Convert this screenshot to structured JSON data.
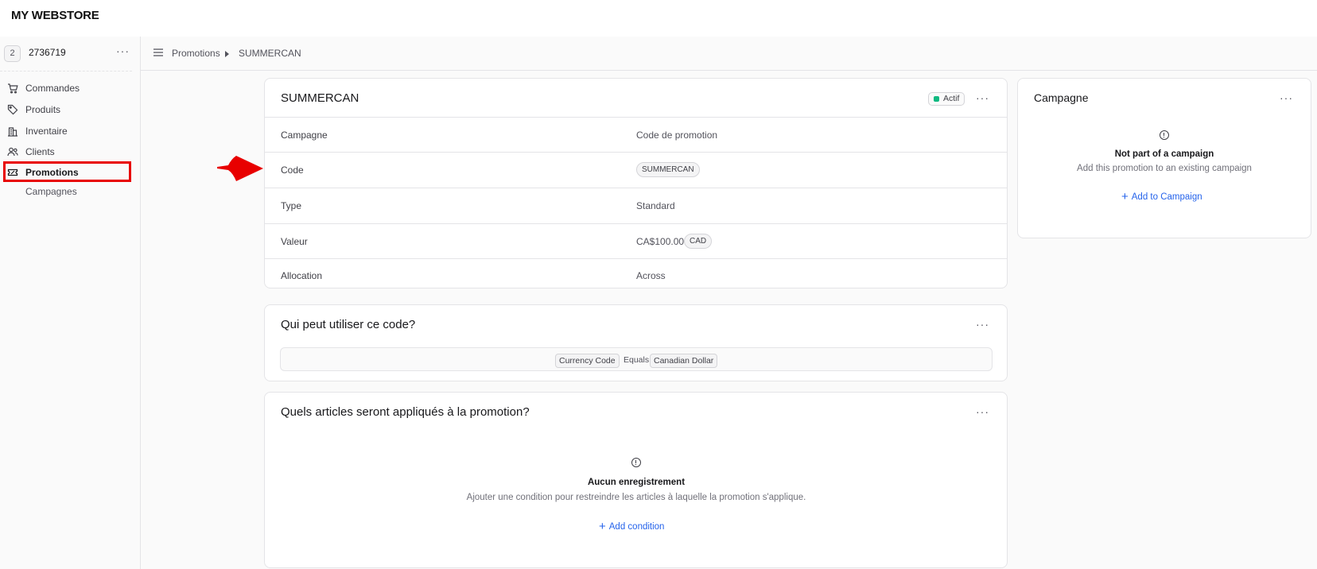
{
  "brand": "MY WEBSTORE",
  "store": {
    "badge": "2",
    "name": "2736719",
    "more": "···"
  },
  "sidebar": {
    "items": [
      {
        "label": "Commandes",
        "icon": "cart-icon"
      },
      {
        "label": "Produits",
        "icon": "tag-icon"
      },
      {
        "label": "Inventaire",
        "icon": "building-icon"
      },
      {
        "label": "Clients",
        "icon": "users-icon"
      },
      {
        "label": "Promotions",
        "icon": "ticket-icon",
        "active": true
      },
      {
        "label": "Campagnes",
        "sub": true
      }
    ]
  },
  "breadcrumb": {
    "items": [
      "Promotions",
      "SUMMERCAN"
    ]
  },
  "promotion": {
    "title": "SUMMERCAN",
    "status": "Actif",
    "status_color": "#10b981",
    "more": "···",
    "rows": [
      {
        "label": "Campagne",
        "value": "Code de promotion"
      },
      {
        "label": "Code",
        "value": "SUMMERCAN"
      },
      {
        "label": "Type",
        "value": "Standard"
      },
      {
        "label": "Valeur",
        "value": "CA$100.00",
        "currency": "CAD"
      },
      {
        "label": "Allocation",
        "value": "Across"
      }
    ]
  },
  "rules": {
    "title": "Qui peut utiliser ce code?",
    "more": "···",
    "condition": {
      "attribute": "Currency Code",
      "operator": "Equals",
      "value": "Canadian Dollar"
    }
  },
  "targets": {
    "title": "Quels articles seront appliqués à la promotion?",
    "more": "···",
    "empty_title": "Aucun enregistrement",
    "empty_text": "Ajouter une condition pour restreindre les articles à laquelle la promotion s'applique.",
    "action": "Add condition"
  },
  "campaign": {
    "title": "Campagne",
    "more": "···",
    "empty_title": "Not part of a campaign",
    "empty_text": "Add this promotion to an existing campaign",
    "action": "Add to Campaign"
  },
  "colors": {
    "highlight": "#e80000",
    "link": "#2563eb"
  }
}
